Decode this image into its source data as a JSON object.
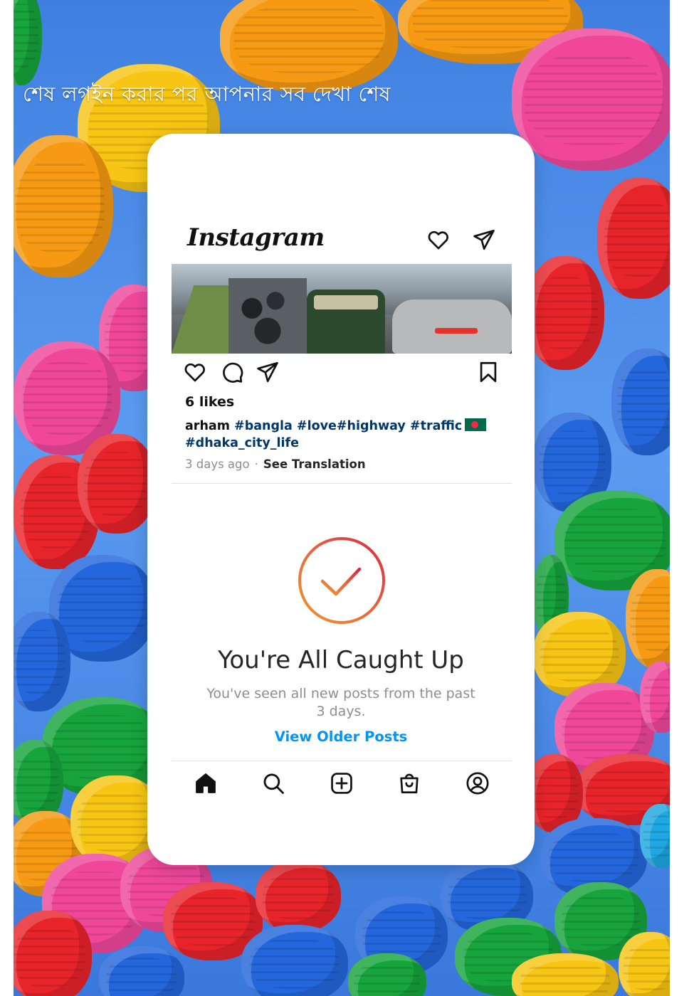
{
  "overlay": {
    "title": "শেষ লগইন করার পর আপনার সব দেখা শেষ"
  },
  "app": {
    "name": "Instagram"
  },
  "header": {
    "icons": [
      "heart-icon",
      "send-icon"
    ]
  },
  "post": {
    "likes": "6 likes",
    "username": "arham",
    "hashtags": "#bangla #love#highway #traffic",
    "hashtags_line2": "#dhaka_city_life",
    "flag": "bangladesh-flag",
    "time": "3 days ago",
    "separator": "·",
    "translate_label": "See Translation",
    "action_icons": [
      "heart-icon",
      "comment-icon",
      "send-icon",
      "bookmark-icon"
    ]
  },
  "caught_up": {
    "title": "You're All Caught Up",
    "subtitle": "You've seen all new posts from the past 3 days.",
    "button": "View Older Posts"
  },
  "tabbar": {
    "icons": [
      "home-icon",
      "search-icon",
      "add-post-icon",
      "shop-icon",
      "profile-icon"
    ]
  },
  "colors": {
    "link_blue": "#0095f6",
    "hashtag_blue": "#00376b",
    "gradient_start": "#f09433",
    "gradient_end": "#dc2743",
    "text_muted": "#8e8e8e"
  }
}
